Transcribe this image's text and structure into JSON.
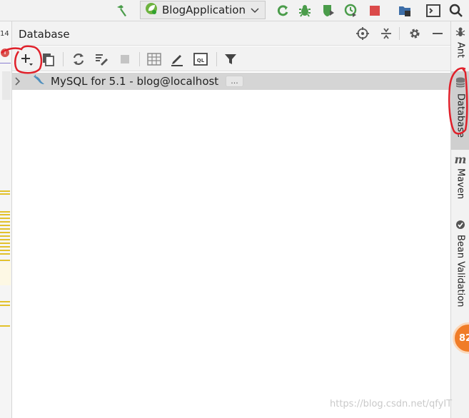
{
  "toolbar": {
    "run_config_label": "BlogApplication",
    "icons": [
      "hammer-icon",
      "spring-leaf-icon",
      "chevron-down-icon",
      "rerun-icon",
      "debug-bug-icon",
      "coverage-icon",
      "profile-icon",
      "stop-icon",
      "project-structure-icon",
      "terminal-icon",
      "search-icon"
    ]
  },
  "editor_strip": {
    "line_number": "14"
  },
  "panel": {
    "title": "Database",
    "header_icons": [
      "locate-icon",
      "collapse-all-icon",
      "gear-icon",
      "minimize-icon"
    ],
    "toolbar_icons": [
      "add-datasource-icon",
      "copy-icon",
      "refresh-icon",
      "schema-sync-icon",
      "stop-icon",
      "table-editor-icon",
      "edit-icon",
      "console-ql-icon",
      "filter-icon"
    ],
    "tree": [
      {
        "label": "MySQL for 5.1 - blog@localhost",
        "more": "..."
      }
    ]
  },
  "right_tools": [
    {
      "label": "Ant",
      "icon": "ant-icon"
    },
    {
      "label": "Database",
      "icon": "database-icon",
      "active": true
    },
    {
      "label": "Maven",
      "icon": "maven-icon"
    },
    {
      "label": "Bean Validation",
      "icon": "bean-validation-icon"
    }
  ],
  "badge": {
    "value": "82"
  },
  "watermark": "https://blog.csdn.net/qfyIT",
  "colors": {
    "accent_green": "#4a9c4a",
    "stop_red": "#db4a4a",
    "annotation_red": "#e0202a",
    "selection_gray": "#d5d5d5",
    "badge_orange": "#f07c27"
  }
}
